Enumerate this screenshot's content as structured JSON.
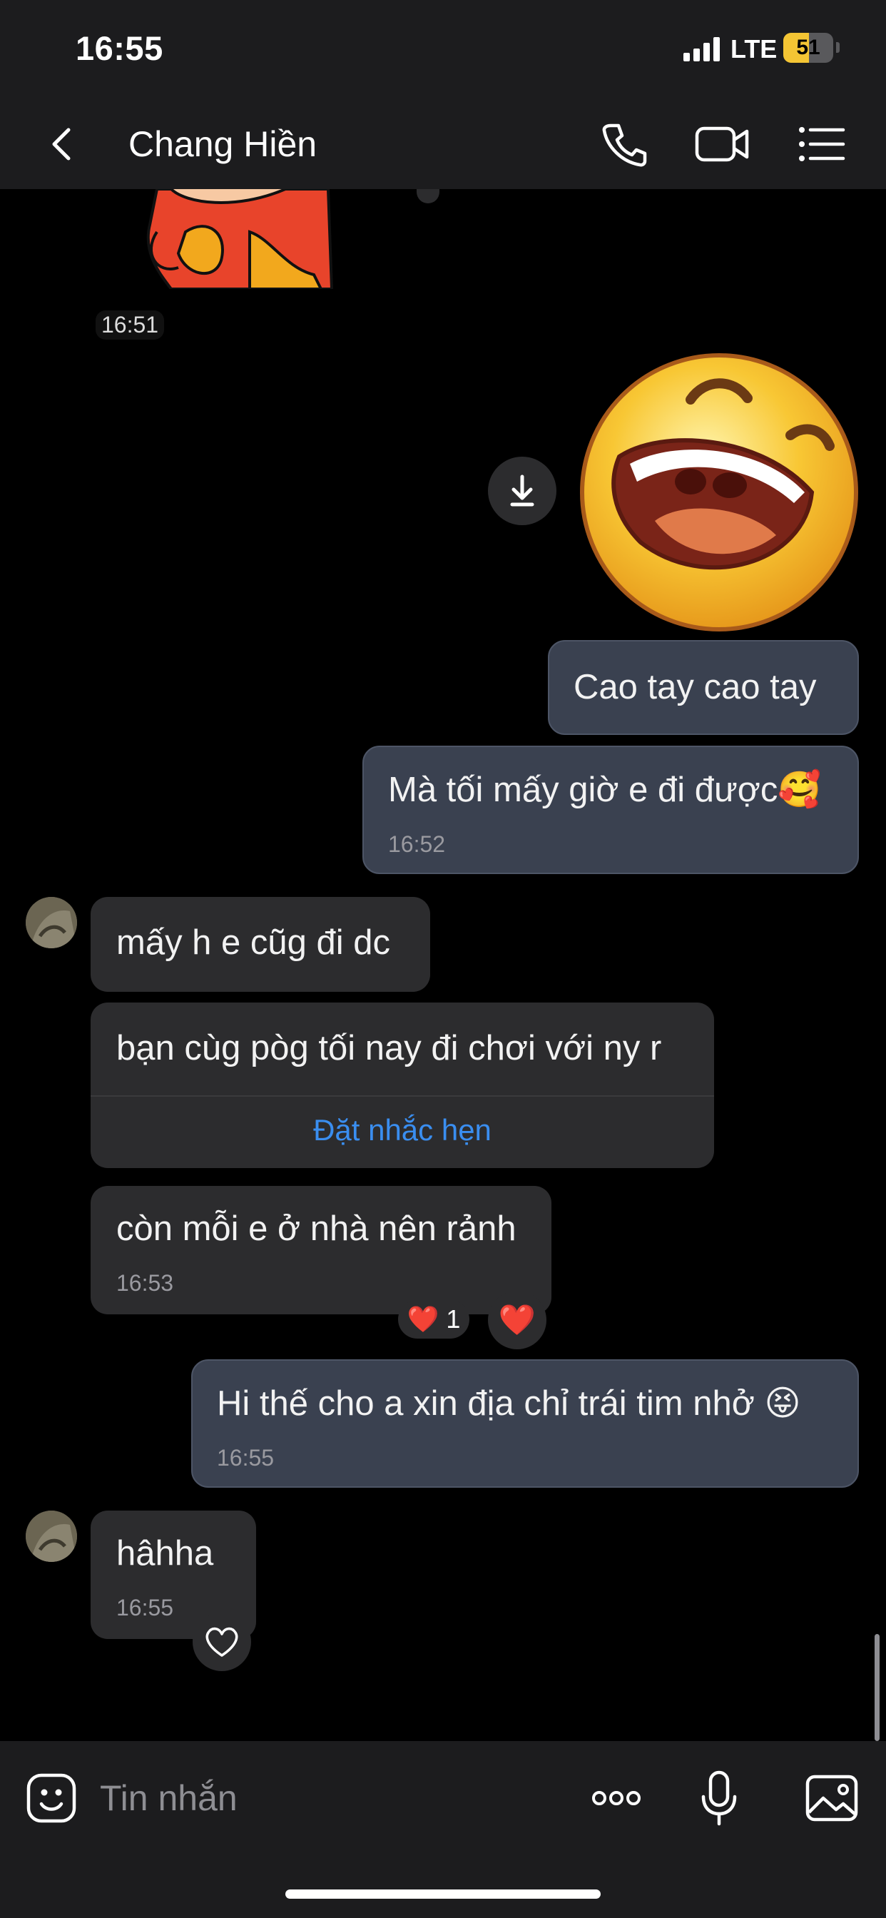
{
  "status_bar": {
    "time": "16:55",
    "network": "LTE",
    "battery": "51",
    "battery_level": 0.51,
    "battery_color": "#f4c534"
  },
  "header": {
    "title": "Chang Hiền",
    "icons": [
      "back-chevron-icon",
      "phone-icon",
      "video-camera-icon",
      "menu-list-icon"
    ]
  },
  "messages": {
    "sticker_time": "16:51",
    "m1_text": "Cao tay cao tay",
    "m2_text": "Mà tối mấy giờ e đi được🥰",
    "m2_time": "16:52",
    "m3_text": "mấy h e cũg đi dc",
    "m4_text": "bạn cùg pòg tối nay đi chơi với ny r",
    "m4_action": "Đặt nhắc hẹn",
    "m5_text": "còn mỗi e ở nhà nên rảnh",
    "m5_time": "16:53",
    "m5_reaction": "❤️ 1",
    "m5_reaction_heart": "❤️",
    "m6_text": "Hi thế cho a xin địa chỉ trái tim nhở 😝",
    "m6_time": "16:55",
    "m7_text": "hâhha",
    "m7_time": "16:55"
  },
  "input_bar": {
    "placeholder": "Tin nhắn",
    "icons": [
      "sticker-emoji-icon",
      "more-options-icon",
      "microphone-icon",
      "image-gallery-icon"
    ]
  },
  "colors": {
    "sent_bubble": "#3a4150",
    "received_bubble": "#2c2c2e",
    "link": "#3a8ef0",
    "background": "#000000"
  }
}
